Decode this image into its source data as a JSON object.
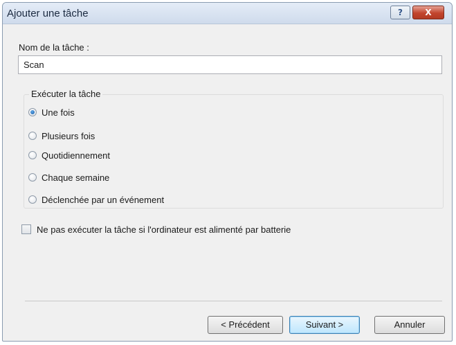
{
  "window": {
    "title": "Ajouter une tâche",
    "help_button": "?",
    "close_button": "X"
  },
  "task_name": {
    "label": "Nom de la tâche :",
    "value": "Scan"
  },
  "run_group": {
    "legend": "Exécuter la tâche",
    "options": [
      {
        "label": "Une fois",
        "selected": true
      },
      {
        "label": "Plusieurs fois",
        "selected": false
      },
      {
        "label": "Quotidiennement",
        "selected": false
      },
      {
        "label": "Chaque semaine",
        "selected": false
      },
      {
        "label": "Déclenchée par un événement",
        "selected": false
      }
    ]
  },
  "battery_option": {
    "label": "Ne pas exécuter la tâche si l'ordinateur est alimenté par batterie",
    "checked": false
  },
  "buttons": {
    "previous": "< Précédent",
    "next": "Suivant >",
    "cancel": "Annuler"
  },
  "colors": {
    "accent": "#1b5fa8",
    "close_button": "#c2452d",
    "dialog_background": "#f0f0f0"
  }
}
